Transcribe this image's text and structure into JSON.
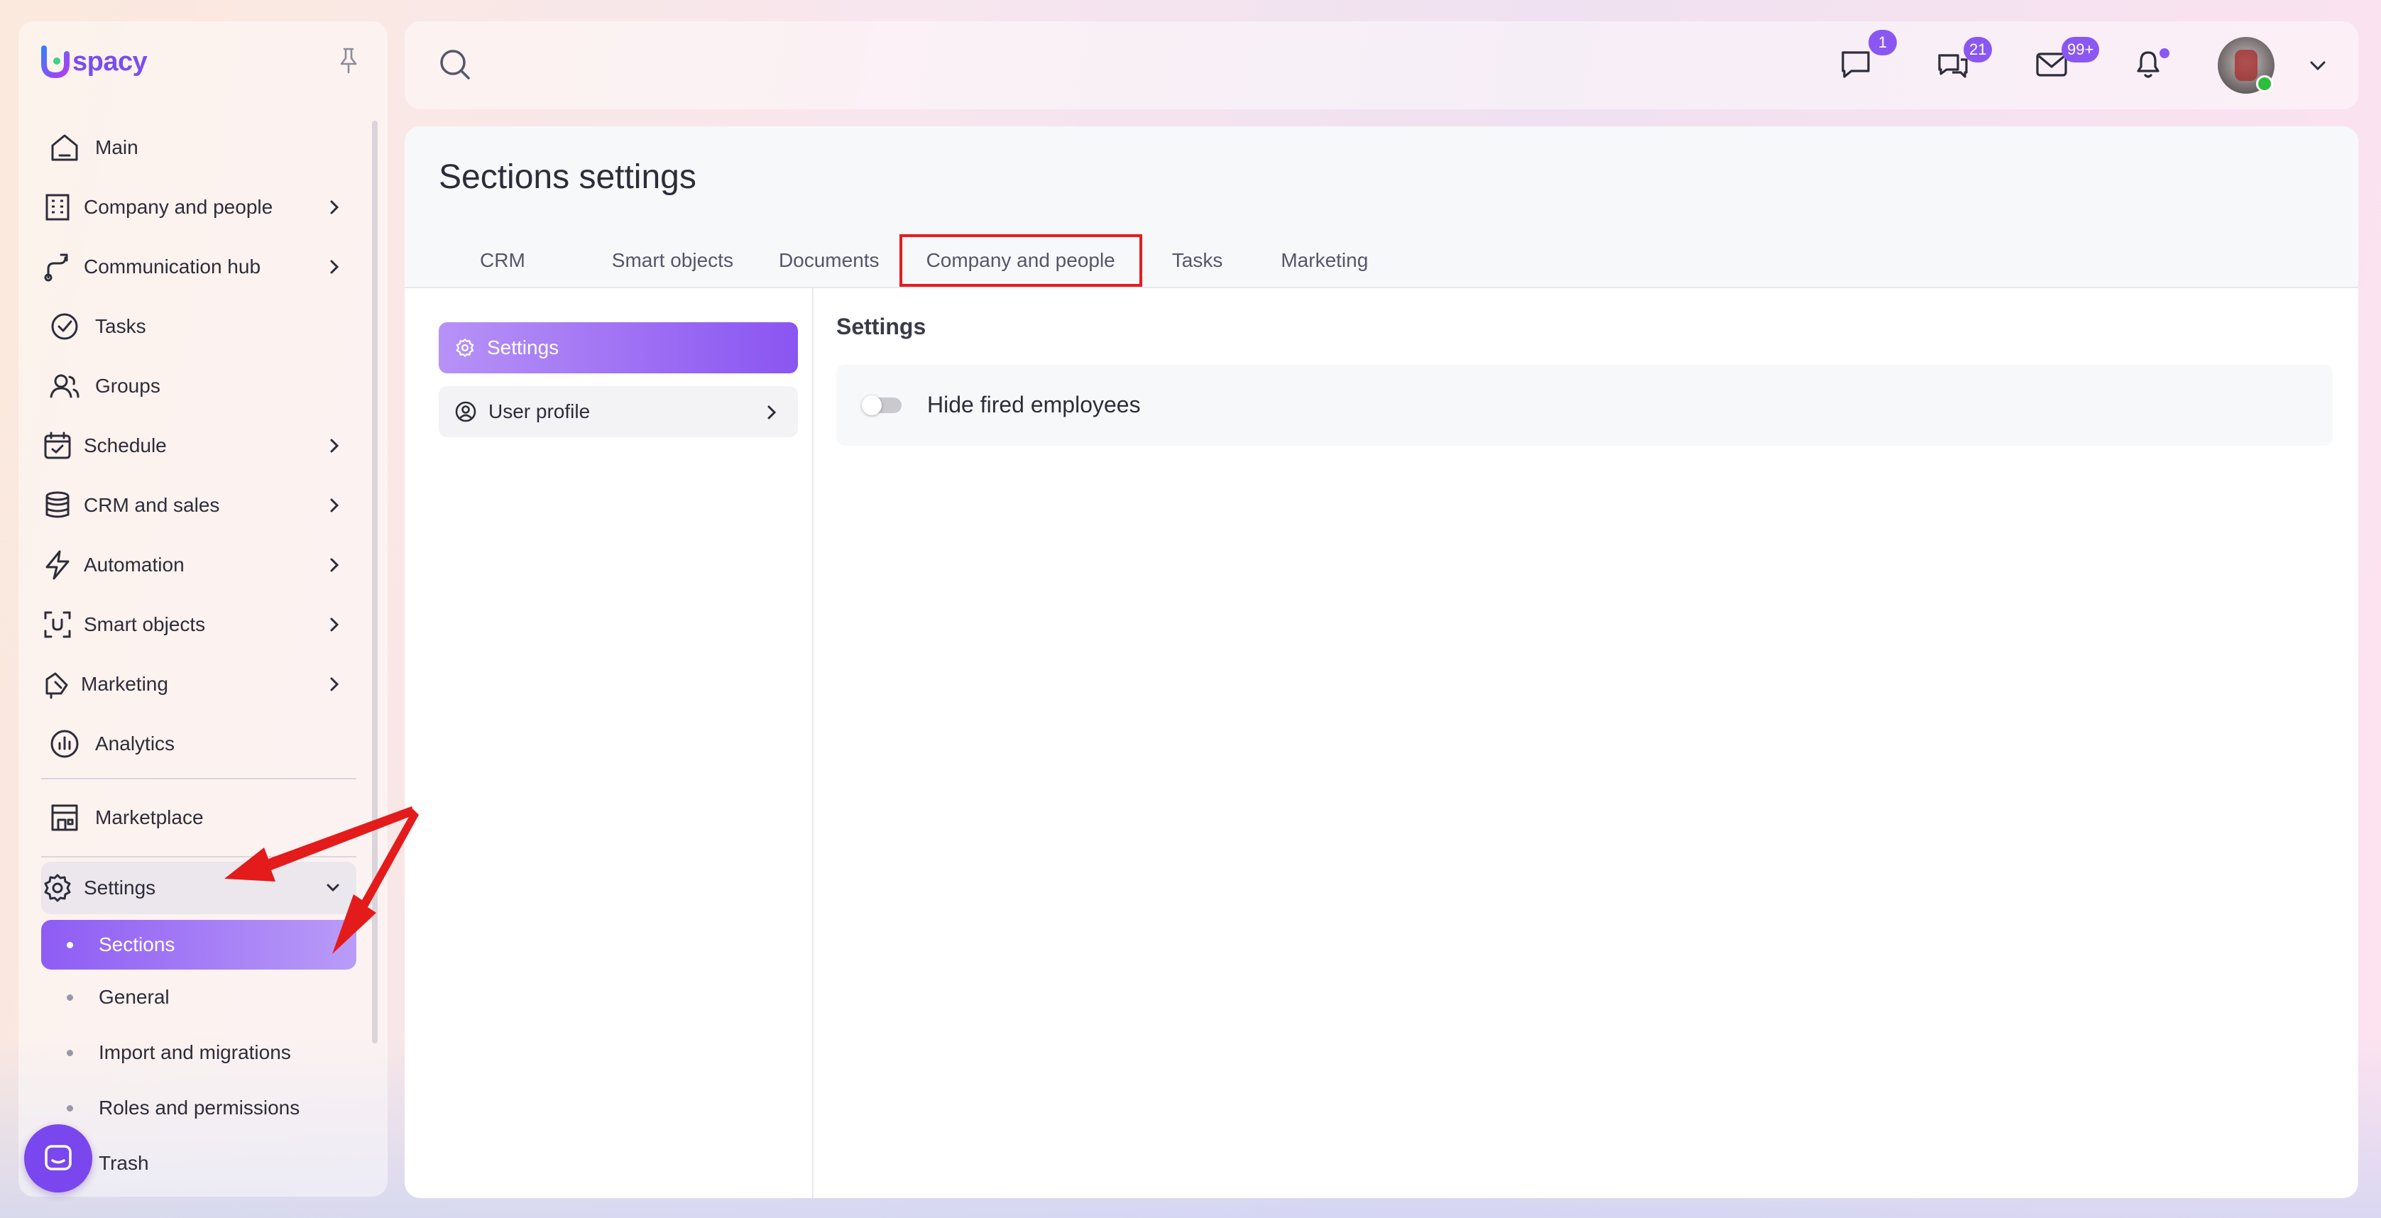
{
  "app": {
    "logo_text": "spacy"
  },
  "sidebar": {
    "items": [
      {
        "label": "Main",
        "icon": "home-icon",
        "has_chevron": false
      },
      {
        "label": "Company and people",
        "icon": "building-icon",
        "has_chevron": true
      },
      {
        "label": "Communication hub",
        "icon": "route-icon",
        "has_chevron": true
      },
      {
        "label": "Tasks",
        "icon": "check-circle-icon",
        "has_chevron": false
      },
      {
        "label": "Groups",
        "icon": "users-icon",
        "has_chevron": false
      },
      {
        "label": "Schedule",
        "icon": "calendar-icon",
        "has_chevron": true
      },
      {
        "label": "CRM and sales",
        "icon": "database-icon",
        "has_chevron": true
      },
      {
        "label": "Automation",
        "icon": "lightning-icon",
        "has_chevron": true
      },
      {
        "label": "Smart objects",
        "icon": "scan-icon",
        "has_chevron": true
      },
      {
        "label": "Marketing",
        "icon": "megaphone-icon",
        "has_chevron": true
      },
      {
        "label": "Analytics",
        "icon": "chart-icon",
        "has_chevron": false
      }
    ],
    "marketplace": {
      "label": "Marketplace",
      "icon": "store-icon"
    },
    "settings": {
      "label": "Settings",
      "icon": "gear-icon",
      "sub_items": [
        {
          "label": "Sections",
          "active": true
        },
        {
          "label": "General",
          "active": false
        },
        {
          "label": "Import and migrations",
          "active": false
        },
        {
          "label": "Roles and permissions",
          "active": false
        },
        {
          "label": "Trash",
          "active": false
        }
      ]
    }
  },
  "topbar": {
    "chat_badge": "1",
    "messages_badge": "21",
    "mail_badge": "99+",
    "notification_dot": true
  },
  "page": {
    "title": "Sections settings",
    "tabs": [
      {
        "label": "CRM",
        "active": false
      },
      {
        "label": "Smart objects",
        "active": false
      },
      {
        "label": "Documents",
        "active": false
      },
      {
        "label": "Company and people",
        "active": true
      },
      {
        "label": "Tasks",
        "active": false
      },
      {
        "label": "Marketing",
        "active": false
      }
    ],
    "left_menu": [
      {
        "label": "Settings",
        "icon": "gear-icon",
        "active": true
      },
      {
        "label": "User profile",
        "icon": "user-circle-icon",
        "active": false
      }
    ],
    "section_heading": "Settings",
    "toggle": {
      "label": "Hide fired employees",
      "on": false
    }
  },
  "colors": {
    "accent": "#8a57f2",
    "highlight_border": "#e51c1c",
    "annotation_arrow": "#e41b1b"
  }
}
